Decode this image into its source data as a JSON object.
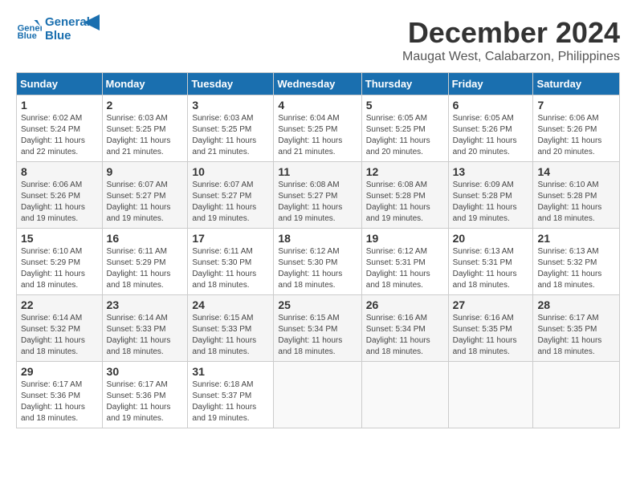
{
  "header": {
    "logo_general": "General",
    "logo_blue": "Blue",
    "month_title": "December 2024",
    "location": "Maugat West, Calabarzon, Philippines"
  },
  "columns": [
    "Sunday",
    "Monday",
    "Tuesday",
    "Wednesday",
    "Thursday",
    "Friday",
    "Saturday"
  ],
  "weeks": [
    [
      {
        "day": "1",
        "sunrise": "6:02 AM",
        "sunset": "5:24 PM",
        "daylight": "11 hours and 22 minutes."
      },
      {
        "day": "2",
        "sunrise": "6:03 AM",
        "sunset": "5:25 PM",
        "daylight": "11 hours and 21 minutes."
      },
      {
        "day": "3",
        "sunrise": "6:03 AM",
        "sunset": "5:25 PM",
        "daylight": "11 hours and 21 minutes."
      },
      {
        "day": "4",
        "sunrise": "6:04 AM",
        "sunset": "5:25 PM",
        "daylight": "11 hours and 21 minutes."
      },
      {
        "day": "5",
        "sunrise": "6:05 AM",
        "sunset": "5:25 PM",
        "daylight": "11 hours and 20 minutes."
      },
      {
        "day": "6",
        "sunrise": "6:05 AM",
        "sunset": "5:26 PM",
        "daylight": "11 hours and 20 minutes."
      },
      {
        "day": "7",
        "sunrise": "6:06 AM",
        "sunset": "5:26 PM",
        "daylight": "11 hours and 20 minutes."
      }
    ],
    [
      {
        "day": "8",
        "sunrise": "6:06 AM",
        "sunset": "5:26 PM",
        "daylight": "11 hours and 19 minutes."
      },
      {
        "day": "9",
        "sunrise": "6:07 AM",
        "sunset": "5:27 PM",
        "daylight": "11 hours and 19 minutes."
      },
      {
        "day": "10",
        "sunrise": "6:07 AM",
        "sunset": "5:27 PM",
        "daylight": "11 hours and 19 minutes."
      },
      {
        "day": "11",
        "sunrise": "6:08 AM",
        "sunset": "5:27 PM",
        "daylight": "11 hours and 19 minutes."
      },
      {
        "day": "12",
        "sunrise": "6:08 AM",
        "sunset": "5:28 PM",
        "daylight": "11 hours and 19 minutes."
      },
      {
        "day": "13",
        "sunrise": "6:09 AM",
        "sunset": "5:28 PM",
        "daylight": "11 hours and 19 minutes."
      },
      {
        "day": "14",
        "sunrise": "6:10 AM",
        "sunset": "5:28 PM",
        "daylight": "11 hours and 18 minutes."
      }
    ],
    [
      {
        "day": "15",
        "sunrise": "6:10 AM",
        "sunset": "5:29 PM",
        "daylight": "11 hours and 18 minutes."
      },
      {
        "day": "16",
        "sunrise": "6:11 AM",
        "sunset": "5:29 PM",
        "daylight": "11 hours and 18 minutes."
      },
      {
        "day": "17",
        "sunrise": "6:11 AM",
        "sunset": "5:30 PM",
        "daylight": "11 hours and 18 minutes."
      },
      {
        "day": "18",
        "sunrise": "6:12 AM",
        "sunset": "5:30 PM",
        "daylight": "11 hours and 18 minutes."
      },
      {
        "day": "19",
        "sunrise": "6:12 AM",
        "sunset": "5:31 PM",
        "daylight": "11 hours and 18 minutes."
      },
      {
        "day": "20",
        "sunrise": "6:13 AM",
        "sunset": "5:31 PM",
        "daylight": "11 hours and 18 minutes."
      },
      {
        "day": "21",
        "sunrise": "6:13 AM",
        "sunset": "5:32 PM",
        "daylight": "11 hours and 18 minutes."
      }
    ],
    [
      {
        "day": "22",
        "sunrise": "6:14 AM",
        "sunset": "5:32 PM",
        "daylight": "11 hours and 18 minutes."
      },
      {
        "day": "23",
        "sunrise": "6:14 AM",
        "sunset": "5:33 PM",
        "daylight": "11 hours and 18 minutes."
      },
      {
        "day": "24",
        "sunrise": "6:15 AM",
        "sunset": "5:33 PM",
        "daylight": "11 hours and 18 minutes."
      },
      {
        "day": "25",
        "sunrise": "6:15 AM",
        "sunset": "5:34 PM",
        "daylight": "11 hours and 18 minutes."
      },
      {
        "day": "26",
        "sunrise": "6:16 AM",
        "sunset": "5:34 PM",
        "daylight": "11 hours and 18 minutes."
      },
      {
        "day": "27",
        "sunrise": "6:16 AM",
        "sunset": "5:35 PM",
        "daylight": "11 hours and 18 minutes."
      },
      {
        "day": "28",
        "sunrise": "6:17 AM",
        "sunset": "5:35 PM",
        "daylight": "11 hours and 18 minutes."
      }
    ],
    [
      {
        "day": "29",
        "sunrise": "6:17 AM",
        "sunset": "5:36 PM",
        "daylight": "11 hours and 18 minutes."
      },
      {
        "day": "30",
        "sunrise": "6:17 AM",
        "sunset": "5:36 PM",
        "daylight": "11 hours and 19 minutes."
      },
      {
        "day": "31",
        "sunrise": "6:18 AM",
        "sunset": "5:37 PM",
        "daylight": "11 hours and 19 minutes."
      },
      null,
      null,
      null,
      null
    ]
  ]
}
